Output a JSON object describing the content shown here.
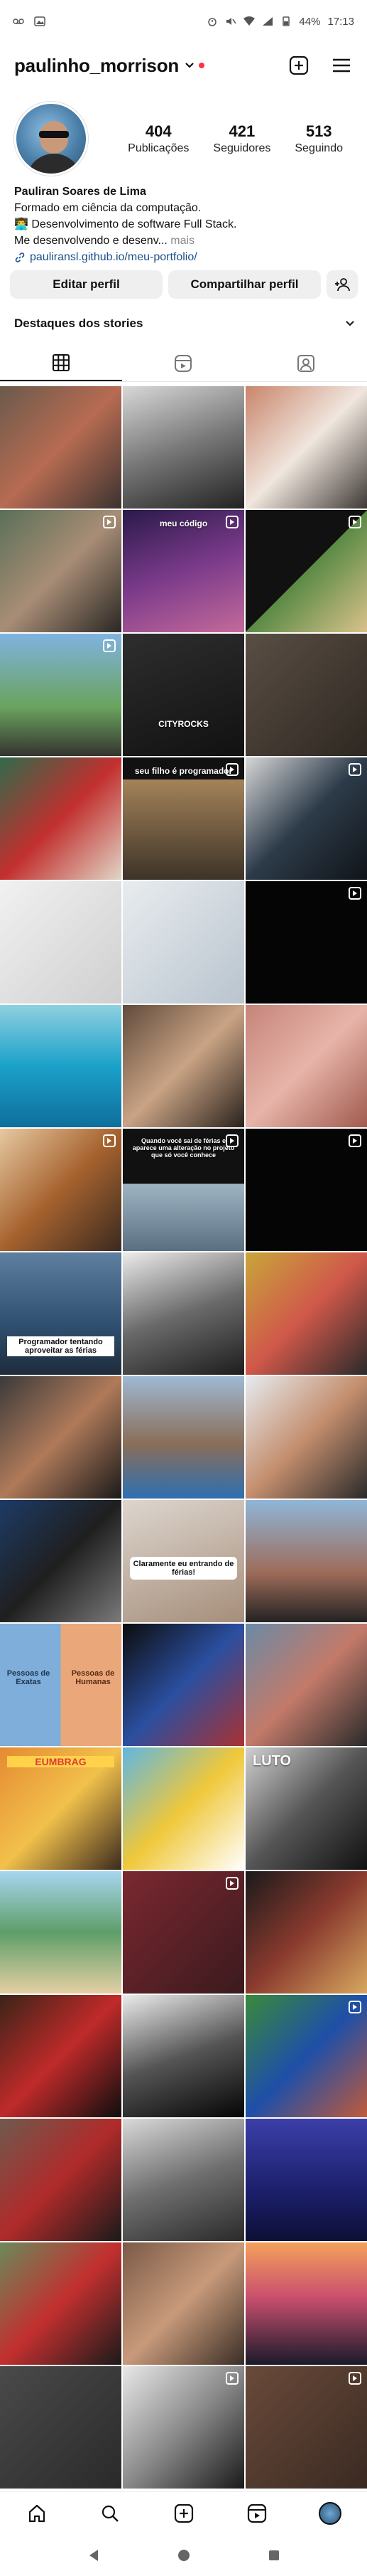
{
  "status_bar": {
    "time": "17:13",
    "battery": "44%"
  },
  "header": {
    "username": "paulinho_morrison"
  },
  "profile": {
    "stats": [
      {
        "value": "404",
        "label": "Publicações"
      },
      {
        "value": "421",
        "label": "Seguidores"
      },
      {
        "value": "513",
        "label": "Seguindo"
      }
    ],
    "name": "Pauliran Soares de Lima",
    "bio_lines": [
      "Formado em ciência da computação.",
      "👨‍💻 Desenvolvimento de software Full Stack.",
      "Me desenvolvendo e desenv..."
    ],
    "more_label": "mais",
    "link": "pauliransl.github.io/meu-portfolio/"
  },
  "actions": {
    "edit_profile": "Editar perfil",
    "share_profile": "Compartilhar perfil"
  },
  "highlights": {
    "label": "Destaques dos stories"
  },
  "grid": {
    "captions": {
      "c4": "meu código",
      "c7": "CITYROCKS",
      "c10": "seu filho é programador",
      "c19": "Quando você sai de férias e aparece uma alteração no projeto que só você conhece",
      "c21": "Programador tentando aproveitar as férias",
      "c27": "Claramente eu entrando de férias!",
      "c30a": "Pessoas de Exatas",
      "c30b": "Pessoas de Humanas",
      "c34": "EUMBRAG",
      "c36": "LUTO"
    }
  }
}
